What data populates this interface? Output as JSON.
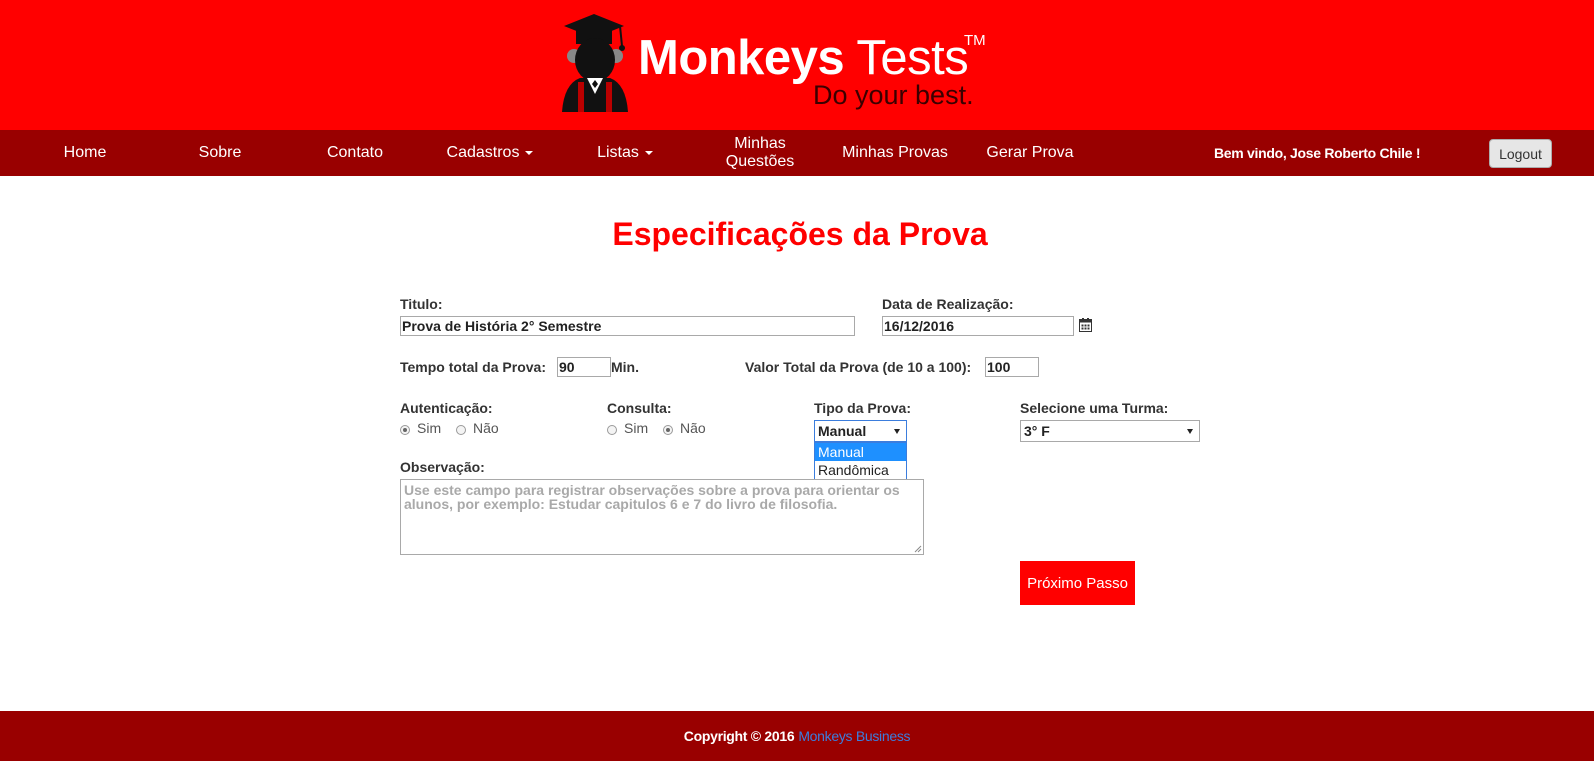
{
  "brand": {
    "name_bold": "Monkeys",
    "name_light": "Tests",
    "trademark": "TM",
    "tagline": "Do your best."
  },
  "nav": {
    "home": "Home",
    "sobre": "Sobre",
    "contato": "Contato",
    "cadastros": "Cadastros",
    "listas": "Listas",
    "minhas_questoes_1": "Minhas",
    "minhas_questoes_2": "Questões",
    "minhas_provas": "Minhas Provas",
    "gerar_prova": "Gerar Prova",
    "welcome": "Bem vindo, Jose Roberto Chile !",
    "logout": "Logout"
  },
  "page": {
    "title": "Especificações da Prova"
  },
  "form": {
    "titulo_label": "Titulo:",
    "titulo_value": "Prova de História 2° Semestre",
    "data_label": "Data de Realização:",
    "data_value": "16/12/2016",
    "tempo_label": "Tempo total da Prova:",
    "tempo_value": "90",
    "tempo_unit": "Min.",
    "valor_label": "Valor Total da Prova (de 10 a 100):",
    "valor_value": "100",
    "autenticacao_label": "Autenticação:",
    "autenticacao_sim": "Sim",
    "autenticacao_nao": "Não",
    "consulta_label": "Consulta:",
    "consulta_sim": "Sim",
    "consulta_nao": "Não",
    "tipo_label": "Tipo da Prova:",
    "tipo_value": "Manual",
    "tipo_options": [
      "Manual",
      "Randômica"
    ],
    "turma_label": "Selecione uma Turma:",
    "turma_value": "3° F",
    "observacao_label": "Observação:",
    "observacao_placeholder": "Use este campo para registrar observações sobre a prova para orientar os alunos, por exemplo: Estudar capitulos 6 e 7 do livro de filosofia.",
    "next_button": "Próximo Passo"
  },
  "footer": {
    "copyright": "Copyright © 2016",
    "company": "Monkeys Business"
  },
  "colors": {
    "header_red": "#ff0000",
    "nav_dark_red": "#990000",
    "link_blue": "#3b7ddd"
  }
}
